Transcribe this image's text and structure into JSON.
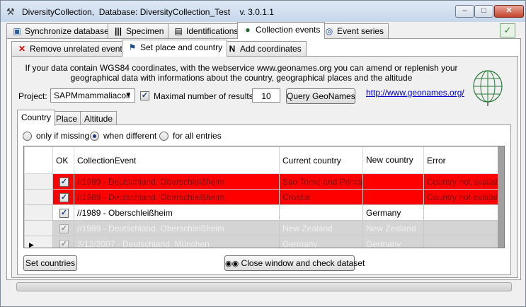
{
  "window": {
    "title": "DiversityCollection,  Database: DiversityCollection_Test    v. 3.0.1.1",
    "app_icon": "tools-icon",
    "min_label": "–",
    "max_label": "□",
    "close_label": "✕"
  },
  "main_tabs": [
    {
      "label": "Synchronize databases",
      "icon": "sync-icon"
    },
    {
      "label": "Specimen",
      "icon": "barcode-icon"
    },
    {
      "label": "Identifications",
      "icon": "document-icon"
    },
    {
      "label": "Collection events",
      "icon": "globe-icon"
    },
    {
      "label": "Event series",
      "icon": "globe-icon"
    }
  ],
  "sub_tabs": [
    {
      "label": "Remove unrelated events",
      "icon": "red-x-icon"
    },
    {
      "label": "Set place and country",
      "icon": "pin-icon"
    },
    {
      "label": "Add coordinates",
      "icon": "north-arrow-icon"
    }
  ],
  "info_text": "If your data contain WGS84 coordinates, with the webservice www.geonames.org you can amend or replenish your geographical data with informations about the country,  geographical places and the altitude",
  "project": {
    "label": "Project:",
    "value": "SAPMmammaliacoll"
  },
  "max_results": {
    "checked": true,
    "label": "Maximal number of results:",
    "value": "10"
  },
  "query_button": "Query GeoNames",
  "link": "http://www.geonames.org/",
  "detail_tabs": [
    "Country",
    "Place",
    "Altitude"
  ],
  "radio_options": [
    {
      "label": "only if missing",
      "selected": false
    },
    {
      "label": "when different",
      "selected": true
    },
    {
      "label": "for all entries",
      "selected": false
    }
  ],
  "grid": {
    "headers": [
      "OK",
      "CollectionEvent",
      "Current country",
      "New country",
      "Error"
    ],
    "rows": [
      {
        "style": "red",
        "ok": true,
        "event": "//1989 - Deutschland. Oberschleißheim",
        "current": "Sao Tome and Principe",
        "new": "",
        "error": "Country not available"
      },
      {
        "style": "red",
        "ok": true,
        "event": "//1989 - Deutschland. Oberschleißheim",
        "current": "Croatia",
        "new": "",
        "error": "Country not available"
      },
      {
        "style": "white",
        "ok": true,
        "event": "//1989 - Oberschleißheim",
        "current": "",
        "new": "Germany",
        "error": ""
      },
      {
        "style": "gray",
        "ok": true,
        "event": "//1989 - Deutschland. Oberschleißheim",
        "current": "New Zealand",
        "new": "New Zealand",
        "error": ""
      },
      {
        "style": "gray",
        "ok": true,
        "event": "3/12/2007 - Deutschland. München",
        "current": "Germany",
        "new": "Germany",
        "error": "",
        "current_row": true
      }
    ]
  },
  "buttons": {
    "set_countries": "Set countries",
    "close_check": "Close window and check dataset"
  },
  "colors": {
    "error_row": "#ff0000",
    "link": "#0000cc"
  }
}
